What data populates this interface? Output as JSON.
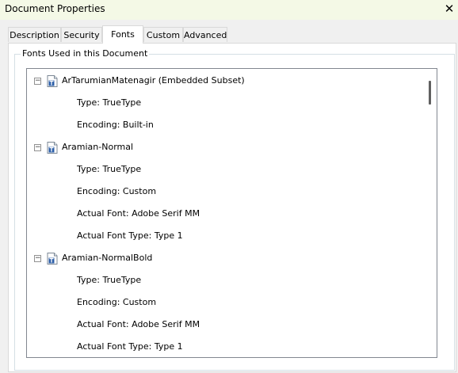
{
  "window": {
    "title": "Document Properties",
    "close_glyph": "✕"
  },
  "tabs": [
    {
      "label": "Description",
      "active": false
    },
    {
      "label": "Security",
      "active": false
    },
    {
      "label": "Fonts",
      "active": true
    },
    {
      "label": "Custom",
      "active": false
    },
    {
      "label": "Advanced",
      "active": false
    }
  ],
  "fonts_group": {
    "label": "Fonts Used in this Document"
  },
  "fonts": [
    {
      "name": "ArTarumianMatenagir (Embedded Subset)",
      "icon": "truetype-font-icon",
      "expander_glyph": "−",
      "details": [
        "Type: TrueType",
        "Encoding: Built-in"
      ]
    },
    {
      "name": "Aramian-Normal",
      "icon": "truetype-font-icon",
      "expander_glyph": "−",
      "details": [
        "Type: TrueType",
        "Encoding: Custom",
        "Actual Font: Adobe Serif MM",
        "Actual Font Type: Type 1"
      ]
    },
    {
      "name": "Aramian-NormalBold",
      "icon": "truetype-font-icon",
      "expander_glyph": "−",
      "details": [
        "Type: TrueType",
        "Encoding: Custom",
        "Actual Font: Adobe Serif MM",
        "Actual Font Type: Type 1"
      ]
    }
  ],
  "colors": {
    "titlebar_bg": "#f4f9e6",
    "dialog_bg": "#f0f0f0",
    "panel_bg": "#ffffff",
    "icon_accent": "#2d5fa8"
  }
}
